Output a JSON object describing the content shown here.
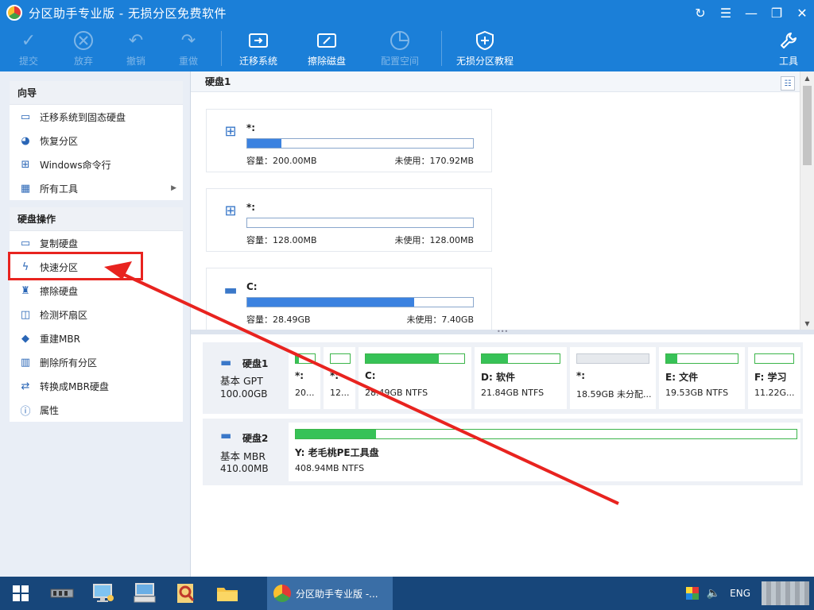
{
  "window": {
    "title": "分区助手专业版 - 无损分区免费软件",
    "controls": [
      "↻",
      "☰",
      "—",
      "❐",
      "✕"
    ]
  },
  "toolbar": {
    "submit": "提交",
    "discard": "放弃",
    "undo": "撤销",
    "redo": "重做",
    "migrate": "迁移系统",
    "wipe": "擦除磁盘",
    "allocate": "配置空间",
    "tutorial": "无损分区教程",
    "tools": "工具"
  },
  "sidebar": {
    "wizard_title": "向导",
    "wizard_items": [
      {
        "label": "迁移系统到固态硬盘",
        "icon": "migrate-icon"
      },
      {
        "label": "恢复分区",
        "icon": "recover-icon"
      },
      {
        "label": "Windows命令行",
        "icon": "windows-icon"
      },
      {
        "label": "所有工具",
        "icon": "tools-grid-icon"
      }
    ],
    "disk_ops_title": "硬盘操作",
    "disk_ops_items": [
      {
        "label": "复制硬盘",
        "icon": "copy-disk-icon"
      },
      {
        "label": "快速分区",
        "icon": "lightning-icon"
      },
      {
        "label": "擦除硬盘",
        "icon": "broom-icon"
      },
      {
        "label": "检测坏扇区",
        "icon": "scan-icon"
      },
      {
        "label": "重建MBR",
        "icon": "tag-icon"
      },
      {
        "label": "删除所有分区",
        "icon": "trash-icon"
      },
      {
        "label": "转换成MBR硬盘",
        "icon": "convert-icon"
      },
      {
        "label": "属性",
        "icon": "info-icon"
      }
    ]
  },
  "disk_view": {
    "header": "硬盘1",
    "cards": [
      {
        "name": "*:",
        "capacity": "容量：200.00MB",
        "free": "未使用：170.92MB",
        "used_fraction": 0.15,
        "icon": "windows-icon"
      },
      {
        "name": "*:",
        "capacity": "容量：128.00MB",
        "free": "未使用：128.00MB",
        "used_fraction": 0.0,
        "icon": "windows-icon"
      },
      {
        "name": "C:",
        "capacity": "容量：28.49GB",
        "free": "未使用：7.40GB",
        "used_fraction": 0.74,
        "icon": "drive-icon"
      }
    ]
  },
  "disks": [
    {
      "name": "硬盘1",
      "type": "基本 GPT",
      "size": "100.00GB",
      "partitions": [
        {
          "name": "*:",
          "info": "20...",
          "fill": 0.15,
          "unallocated": false
        },
        {
          "name": "*:",
          "info": "12...",
          "fill": 0.0,
          "unallocated": false
        },
        {
          "name": "C:",
          "info": "28.49GB NTFS",
          "fill": 0.74,
          "unallocated": false
        },
        {
          "name": "D: 软件",
          "info": "21.84GB NTFS",
          "fill": 0.34,
          "unallocated": false
        },
        {
          "name": "*:",
          "info": "18.59GB 未分配...",
          "fill": 0.0,
          "unallocated": true
        },
        {
          "name": "E: 文件",
          "info": "19.53GB NTFS",
          "fill": 0.15,
          "unallocated": false
        },
        {
          "name": "F: 学习",
          "info": "11.22G...",
          "fill": 0.0,
          "unallocated": false
        }
      ]
    },
    {
      "name": "硬盘2",
      "type": "基本 MBR",
      "size": "410.00MB",
      "partitions": [
        {
          "name": "Y: 老毛桃PE工具盘",
          "info": "408.94MB NTFS",
          "fill": 0.16,
          "unallocated": false
        }
      ]
    }
  ],
  "taskbar": {
    "active_app": "分区助手专业版 -...",
    "language": "ENG"
  }
}
